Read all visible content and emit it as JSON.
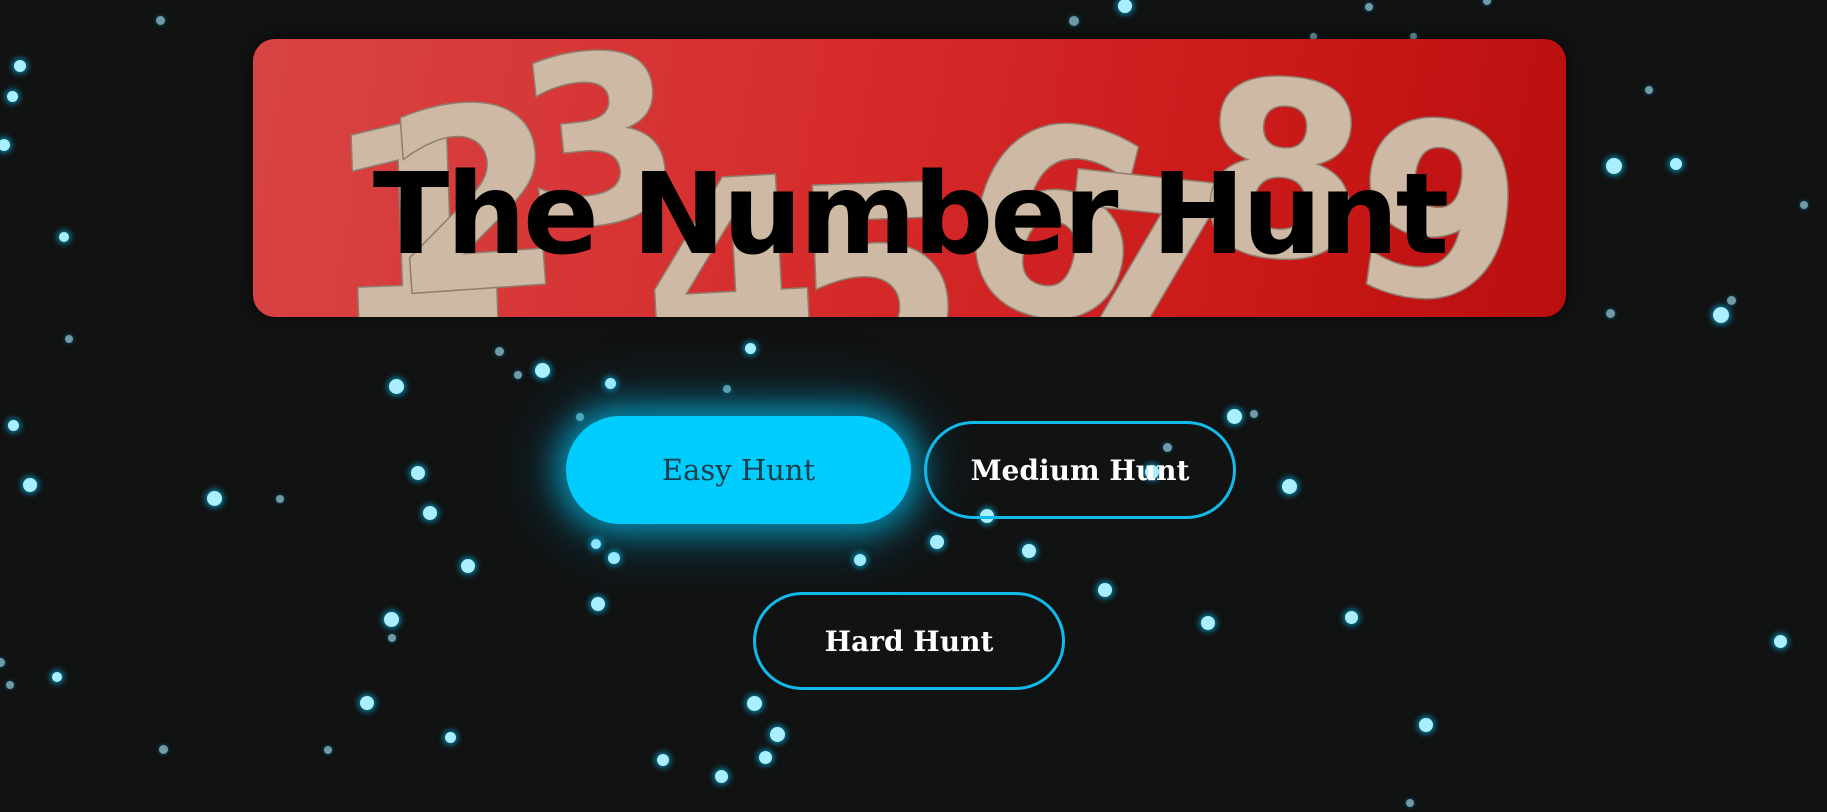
{
  "banner": {
    "title": "The Number Hunt",
    "background_digits": [
      "1",
      "2",
      "3",
      "4",
      "5",
      "6",
      "7",
      "8",
      "9"
    ]
  },
  "buttons": {
    "easy": "Easy Hunt",
    "medium": "Medium Hunt",
    "hard": "Hard Hunt"
  },
  "colors": {
    "background": "#111212",
    "accent": "#00cdfe",
    "accent_border": "#11baea",
    "banner_red": "#d62b2b",
    "digit_tan": "#cdb9a4",
    "particle": "#a9efff"
  }
}
